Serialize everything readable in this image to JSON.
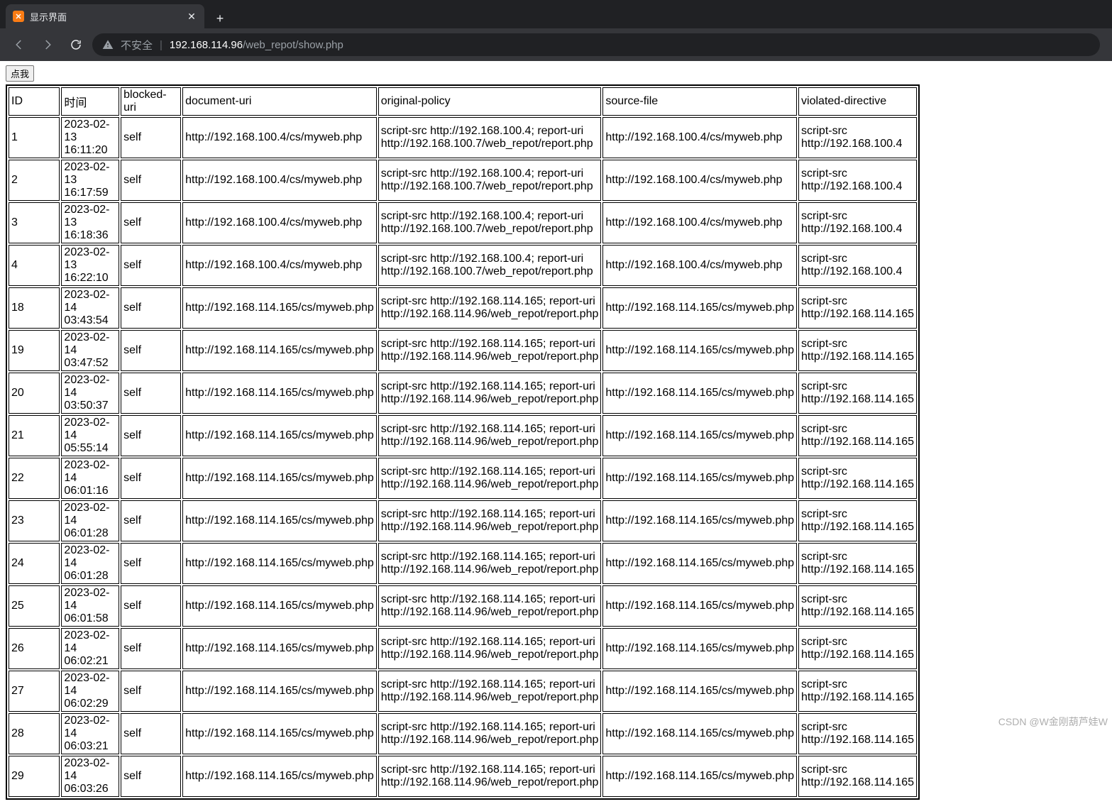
{
  "browser": {
    "tab_title": "显示界面",
    "security_label": "不安全",
    "url_host": "192.168.114.96",
    "url_path": "/web_repot/show.php"
  },
  "page": {
    "button_label": "点我"
  },
  "table": {
    "headers": [
      "ID",
      "时间",
      "blocked-uri",
      "document-uri",
      "original-policy",
      "source-file",
      "violated-directive"
    ],
    "rows": [
      {
        "id": "1",
        "time": "2023-02-13 16:11:20",
        "blocked": "self",
        "doc": "http://192.168.100.4/cs/myweb.php",
        "policy": "script-src http://192.168.100.4; report-uri http://192.168.100.7/web_repot/report.php",
        "src": "http://192.168.100.4/cs/myweb.php",
        "vio": "script-src http://192.168.100.4"
      },
      {
        "id": "2",
        "time": "2023-02-13 16:17:59",
        "blocked": "self",
        "doc": "http://192.168.100.4/cs/myweb.php",
        "policy": "script-src http://192.168.100.4; report-uri http://192.168.100.7/web_repot/report.php",
        "src": "http://192.168.100.4/cs/myweb.php",
        "vio": "script-src http://192.168.100.4"
      },
      {
        "id": "3",
        "time": "2023-02-13 16:18:36",
        "blocked": "self",
        "doc": "http://192.168.100.4/cs/myweb.php",
        "policy": "script-src http://192.168.100.4; report-uri http://192.168.100.7/web_repot/report.php",
        "src": "http://192.168.100.4/cs/myweb.php",
        "vio": "script-src http://192.168.100.4"
      },
      {
        "id": "4",
        "time": "2023-02-13 16:22:10",
        "blocked": "self",
        "doc": "http://192.168.100.4/cs/myweb.php",
        "policy": "script-src http://192.168.100.4; report-uri http://192.168.100.7/web_repot/report.php",
        "src": "http://192.168.100.4/cs/myweb.php",
        "vio": "script-src http://192.168.100.4"
      },
      {
        "id": "18",
        "time": "2023-02-14 03:43:54",
        "blocked": "self",
        "doc": "http://192.168.114.165/cs/myweb.php",
        "policy": "script-src http://192.168.114.165; report-uri http://192.168.114.96/web_repot/report.php",
        "src": "http://192.168.114.165/cs/myweb.php",
        "vio": "script-src http://192.168.114.165"
      },
      {
        "id": "19",
        "time": "2023-02-14 03:47:52",
        "blocked": "self",
        "doc": "http://192.168.114.165/cs/myweb.php",
        "policy": "script-src http://192.168.114.165; report-uri http://192.168.114.96/web_repot/report.php",
        "src": "http://192.168.114.165/cs/myweb.php",
        "vio": "script-src http://192.168.114.165"
      },
      {
        "id": "20",
        "time": "2023-02-14 03:50:37",
        "blocked": "self",
        "doc": "http://192.168.114.165/cs/myweb.php",
        "policy": "script-src http://192.168.114.165; report-uri http://192.168.114.96/web_repot/report.php",
        "src": "http://192.168.114.165/cs/myweb.php",
        "vio": "script-src http://192.168.114.165"
      },
      {
        "id": "21",
        "time": "2023-02-14 05:55:14",
        "blocked": "self",
        "doc": "http://192.168.114.165/cs/myweb.php",
        "policy": "script-src http://192.168.114.165; report-uri http://192.168.114.96/web_repot/report.php",
        "src": "http://192.168.114.165/cs/myweb.php",
        "vio": "script-src http://192.168.114.165"
      },
      {
        "id": "22",
        "time": "2023-02-14 06:01:16",
        "blocked": "self",
        "doc": "http://192.168.114.165/cs/myweb.php",
        "policy": "script-src http://192.168.114.165; report-uri http://192.168.114.96/web_repot/report.php",
        "src": "http://192.168.114.165/cs/myweb.php",
        "vio": "script-src http://192.168.114.165"
      },
      {
        "id": "23",
        "time": "2023-02-14 06:01:28",
        "blocked": "self",
        "doc": "http://192.168.114.165/cs/myweb.php",
        "policy": "script-src http://192.168.114.165; report-uri http://192.168.114.96/web_repot/report.php",
        "src": "http://192.168.114.165/cs/myweb.php",
        "vio": "script-src http://192.168.114.165"
      },
      {
        "id": "24",
        "time": "2023-02-14 06:01:28",
        "blocked": "self",
        "doc": "http://192.168.114.165/cs/myweb.php",
        "policy": "script-src http://192.168.114.165; report-uri http://192.168.114.96/web_repot/report.php",
        "src": "http://192.168.114.165/cs/myweb.php",
        "vio": "script-src http://192.168.114.165"
      },
      {
        "id": "25",
        "time": "2023-02-14 06:01:58",
        "blocked": "self",
        "doc": "http://192.168.114.165/cs/myweb.php",
        "policy": "script-src http://192.168.114.165; report-uri http://192.168.114.96/web_repot/report.php",
        "src": "http://192.168.114.165/cs/myweb.php",
        "vio": "script-src http://192.168.114.165"
      },
      {
        "id": "26",
        "time": "2023-02-14 06:02:21",
        "blocked": "self",
        "doc": "http://192.168.114.165/cs/myweb.php",
        "policy": "script-src http://192.168.114.165; report-uri http://192.168.114.96/web_repot/report.php",
        "src": "http://192.168.114.165/cs/myweb.php",
        "vio": "script-src http://192.168.114.165"
      },
      {
        "id": "27",
        "time": "2023-02-14 06:02:29",
        "blocked": "self",
        "doc": "http://192.168.114.165/cs/myweb.php",
        "policy": "script-src http://192.168.114.165; report-uri http://192.168.114.96/web_repot/report.php",
        "src": "http://192.168.114.165/cs/myweb.php",
        "vio": "script-src http://192.168.114.165"
      },
      {
        "id": "28",
        "time": "2023-02-14 06:03:21",
        "blocked": "self",
        "doc": "http://192.168.114.165/cs/myweb.php",
        "policy": "script-src http://192.168.114.165; report-uri http://192.168.114.96/web_repot/report.php",
        "src": "http://192.168.114.165/cs/myweb.php",
        "vio": "script-src http://192.168.114.165"
      },
      {
        "id": "29",
        "time": "2023-02-14 06:03:26",
        "blocked": "self",
        "doc": "http://192.168.114.165/cs/myweb.php",
        "policy": "script-src http://192.168.114.165; report-uri http://192.168.114.96/web_repot/report.php",
        "src": "http://192.168.114.165/cs/myweb.php",
        "vio": "script-src http://192.168.114.165"
      }
    ]
  },
  "watermark": "CSDN @W金刚葫芦娃W"
}
